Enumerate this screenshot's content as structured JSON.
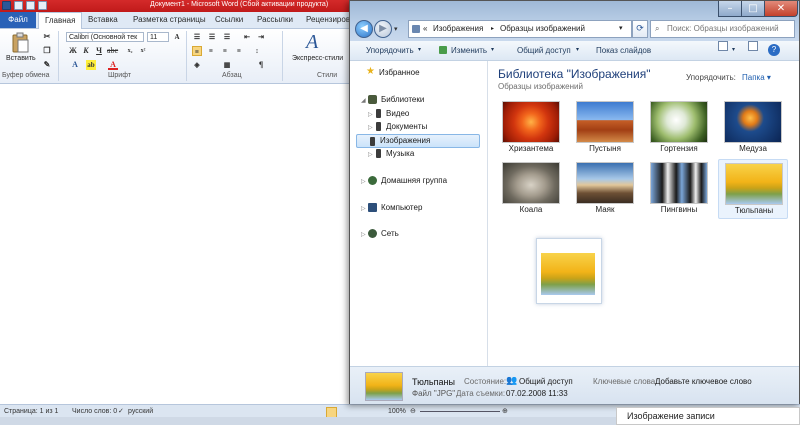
{
  "word": {
    "title": "Документ1 - Microsoft Word (Сбой активации продукта)",
    "tabs": [
      "Файл",
      "Главная",
      "Вставка",
      "Разметка страницы",
      "Ссылки",
      "Рассылки",
      "Рецензирова"
    ],
    "paste_label": "Вставить",
    "font_name": "Calibri (Основной тек",
    "font_size": "11",
    "styles_label": "Экспресс-стили",
    "groups": {
      "clipboard": "Буфер обмена",
      "font": "Шрифт",
      "paragraph": "Абзац",
      "styles": "Стили"
    },
    "status": {
      "page": "Страница: 1 из 1",
      "words": "Число слов: 0",
      "language": "русский",
      "zoom": "100%"
    }
  },
  "explorer": {
    "breadcrumb": {
      "root": "«",
      "part1": "Изображения",
      "sep": "▸",
      "part2": "Образцы изображений"
    },
    "search_placeholder": "Поиск: Образцы изображений",
    "toolbar": {
      "organize": "Упорядочить",
      "edit": "Изменить",
      "share": "Общий доступ",
      "slideshow": "Показ слайдов"
    },
    "nav": {
      "favorites": "Избранное",
      "libraries": "Библиотеки",
      "video": "Видео",
      "documents": "Документы",
      "pictures": "Изображения",
      "music": "Музыка",
      "homegroup": "Домашняя группа",
      "computer": "Компьютер",
      "network": "Сеть"
    },
    "library_title": "Библиотека \"Изображения\"",
    "library_subtitle": "Образцы изображений",
    "arrange_label": "Упорядочить:",
    "arrange_value": "Папка",
    "thumbnails": [
      "Хризантема",
      "Пустыня",
      "Гортензия",
      "Медуза",
      "Коала",
      "Маяк",
      "Пингвины",
      "Тюльпаны"
    ],
    "details": {
      "name": "Тюльпаны",
      "type": "Файл \"JPG\"",
      "state_label": "Состояние:",
      "state_value": "Общий доступ",
      "keywords_label": "Ключевые слова:",
      "keywords_value": "Добавьте ключевое слово",
      "date_label": "Дата съемки:",
      "date_value": "07.02.2008 11:33"
    }
  },
  "popup": {
    "label": "Изображение записи"
  },
  "colors": {
    "word_title": "#c01a1a",
    "accent": "#2160b0",
    "library_title": "#1e3f7a"
  }
}
